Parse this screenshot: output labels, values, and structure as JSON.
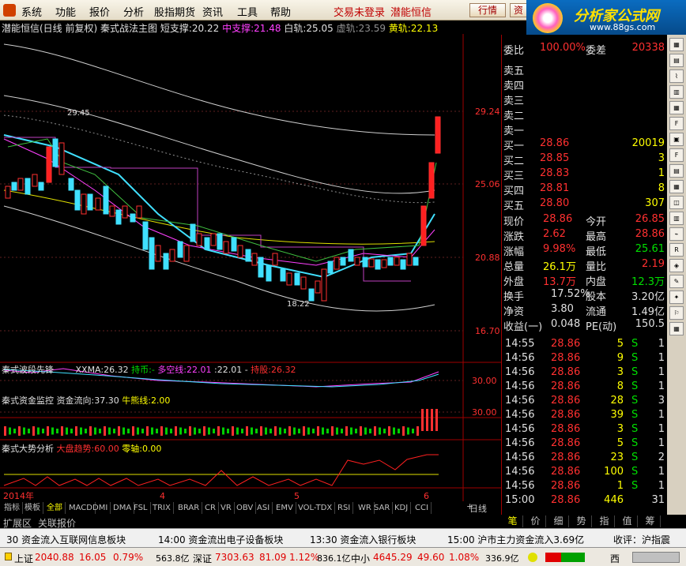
{
  "menu": {
    "items": [
      "系统",
      "功能",
      "报价",
      "分析",
      "股指期货",
      "资讯",
      "工具",
      "帮助"
    ],
    "trade_status": "交易未登录",
    "broker": "潜能恒信",
    "btn_quote": "行情",
    "btn_info": "资"
  },
  "brand": {
    "name": "分析家公式网",
    "url": "www.88gs.com"
  },
  "chart_title": {
    "stock": "潜能恒信(日线 前复权)",
    "indicator": "秦式战法主图",
    "short_label": "短支撑:",
    "short_val": "20.22",
    "mid_label": "中支撑:",
    "mid_val": "21.48",
    "white_label": "白轨:",
    "white_val": "25.05",
    "virtual_label": "虚轨:",
    "virtual_val": "23.59",
    "yellow_label": "黄轨:",
    "yellow_val": "22.13"
  },
  "price_axis": [
    "29.24",
    "25.06",
    "20.88",
    "16.70"
  ],
  "annotations": {
    "high": "29.45",
    "low": "18.22"
  },
  "x_axis": {
    "year": "2014年",
    "m4": "4",
    "m5": "5",
    "m6": "6"
  },
  "sub1": {
    "name": "秦式波段先锋",
    "xxma_label": "XXMA:",
    "xxma_val": "26.32",
    "hold_label": "持币:",
    "hold_val": "-",
    "ls_label": "多空线:",
    "ls_val": "22.01",
    "dot_label": ":",
    "dot_val": "22.01",
    "sep": "-",
    "stock_label": "持股:",
    "stock_val": "26.32",
    "axis": "30.00"
  },
  "sub2": {
    "name": "秦式资金监控",
    "flow_label": "资金流向:",
    "flow_val": "37.30",
    "bull_label": "牛熊线:",
    "bull_val": "2.00",
    "axis": "30.00"
  },
  "sub3": {
    "name": "秦式大势分析",
    "trend_label": "大盘趋势:",
    "trend_val": "60.00",
    "zero_label": "零轴:",
    "zero_val": "0.00"
  },
  "tabs": [
    "指标",
    "模板",
    "全部",
    "MACD",
    "DMI",
    "DMA",
    "FSL",
    "TRIX",
    "BRAR",
    "CR",
    "VR",
    "OBV",
    "ASI",
    "EMV",
    "VOL-TDX",
    "RSI",
    "WR",
    "SAR",
    "KDJ",
    "CCI"
  ],
  "period": "日线",
  "nav_plus": "+",
  "nav_minus": "-",
  "ext_tabs": [
    "扩展区",
    "关联报价"
  ],
  "quote": {
    "weibi_label": "委比",
    "weibi": "100.00%",
    "weicha_label": "委差",
    "weicha": "20338",
    "sells": [
      {
        "label": "卖五",
        "price": "",
        "vol": ""
      },
      {
        "label": "卖四",
        "price": "",
        "vol": ""
      },
      {
        "label": "卖三",
        "price": "",
        "vol": ""
      },
      {
        "label": "卖二",
        "price": "",
        "vol": ""
      },
      {
        "label": "卖一",
        "price": "",
        "vol": ""
      }
    ],
    "buys": [
      {
        "label": "买一",
        "price": "28.86",
        "vol": "20019"
      },
      {
        "label": "买二",
        "price": "28.85",
        "vol": "3"
      },
      {
        "label": "买三",
        "price": "28.83",
        "vol": "1"
      },
      {
        "label": "买四",
        "price": "28.81",
        "vol": "8"
      },
      {
        "label": "买五",
        "price": "28.80",
        "vol": "307"
      }
    ],
    "stats": [
      {
        "l1": "现价",
        "v1": "28.86",
        "l2": "今开",
        "v2": "26.85"
      },
      {
        "l1": "涨跌",
        "v1": "2.62",
        "l2": "最高",
        "v2": "28.86"
      },
      {
        "l1": "涨幅",
        "v1": "9.98%",
        "l2": "最低",
        "v2": "25.61"
      },
      {
        "l1": "总量",
        "v1": "26.1万",
        "l2": "量比",
        "v2": "2.19"
      },
      {
        "l1": "外盘",
        "v1": "13.7万",
        "l2": "内盘",
        "v2": "12.3万"
      }
    ],
    "stats2": [
      {
        "l1": "换手",
        "v1": "17.52%",
        "l2": "股本",
        "v2": "3.20亿"
      },
      {
        "l1": "净资",
        "v1": "3.80",
        "l2": "流通",
        "v2": "1.49亿"
      },
      {
        "l1": "收益(一)",
        "v1": "0.048",
        "l2": "PE(动)",
        "v2": "150.5"
      }
    ],
    "ticks": [
      {
        "t": "14:55",
        "p": "28.86",
        "v": "5",
        "bs": "S",
        "n": "1"
      },
      {
        "t": "14:56",
        "p": "28.86",
        "v": "9",
        "bs": "S",
        "n": "1"
      },
      {
        "t": "14:56",
        "p": "28.86",
        "v": "3",
        "bs": "S",
        "n": "1"
      },
      {
        "t": "14:56",
        "p": "28.86",
        "v": "8",
        "bs": "S",
        "n": "1"
      },
      {
        "t": "14:56",
        "p": "28.86",
        "v": "28",
        "bs": "S",
        "n": "3"
      },
      {
        "t": "14:56",
        "p": "28.86",
        "v": "39",
        "bs": "S",
        "n": "1"
      },
      {
        "t": "14:56",
        "p": "28.86",
        "v": "3",
        "bs": "S",
        "n": "1"
      },
      {
        "t": "14:56",
        "p": "28.86",
        "v": "5",
        "bs": "S",
        "n": "1"
      },
      {
        "t": "14:56",
        "p": "28.86",
        "v": "23",
        "bs": "S",
        "n": "2"
      },
      {
        "t": "14:56",
        "p": "28.86",
        "v": "100",
        "bs": "S",
        "n": "1"
      },
      {
        "t": "14:56",
        "p": "28.86",
        "v": "1",
        "bs": "S",
        "n": "1"
      },
      {
        "t": "15:00",
        "p": "28.86",
        "v": "446",
        "bs": "",
        "n": "31"
      }
    ]
  },
  "right_tabs": [
    "笔",
    "价",
    "细",
    "势",
    "指",
    "值",
    "筹"
  ],
  "news": [
    {
      "time": "30",
      "text": "资金流入互联网信息板块"
    },
    {
      "time": "14:00",
      "text": "资金流出电子设备板块"
    },
    {
      "time": "13:30",
      "text": "资金流入银行板块"
    },
    {
      "time": "15:00",
      "text": "沪市主力资金流入3.69亿"
    },
    {
      "time": "",
      "text": "收评：沪指震"
    }
  ],
  "status": {
    "sh_label": "上证",
    "sh_val": "2040.88",
    "sh_chg": "16.05",
    "sh_pct": "0.79%",
    "sh_amt": "563.8亿",
    "sz_label": "深证",
    "sz_val": "7303.63",
    "sz_chg": "81.09",
    "sz_pct": "1.12%",
    "sz_amt": "836.1亿",
    "mid_label": "中小",
    "mid_val": "4645.29",
    "mid_chg": "49.60",
    "mid_pct": "1.08%",
    "mid_amt": "336.9亿",
    "west": "西"
  }
}
